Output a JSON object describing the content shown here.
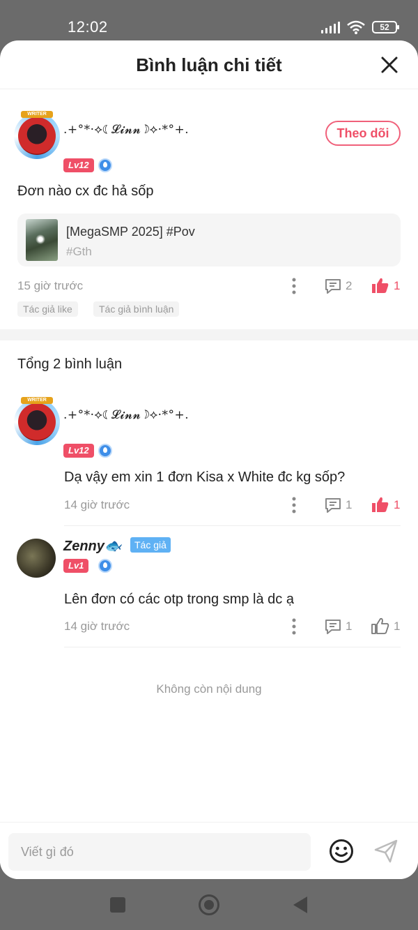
{
  "status_bar": {
    "time": "12:02",
    "battery": "52"
  },
  "header": {
    "title": "Bình luận chi tiết"
  },
  "post": {
    "username": ".+°*·⟡☾𝓛𝓲𝓷𝓷☽⟡·*°+.",
    "level": "Lv12",
    "follow_label": "Theo dõi",
    "text": "Đơn nào cx đc hả sốp",
    "card": {
      "title": "[MegaSMP 2025] #Pov",
      "tag": "#Gth"
    },
    "time": "15 giờ trước",
    "reply_count": "2",
    "like_count": "1",
    "chips": [
      "Tác giả like",
      "Tác giả bình luận"
    ]
  },
  "replies_header": "Tổng 2 bình luận",
  "comments": [
    {
      "username": ".+°*·⟡☾𝓛𝓲𝓷𝓷☽⟡·*°+.",
      "level": "Lv12",
      "text": "Dạ vậy em xin 1 đơn Kisa x White đc kg sốp?",
      "time": "14 giờ trước",
      "reply_count": "1",
      "like_count": "1"
    },
    {
      "username": "Zenny🐟",
      "author_tag": "Tác giả",
      "level": "Lv1",
      "text": "Lên đơn có các otp trong smp là dc ạ",
      "time": "14 giờ trước",
      "reply_count": "1",
      "like_count": "1"
    }
  ],
  "end_text": "Không còn nội dung",
  "composer": {
    "placeholder": "Viết gì đó"
  },
  "colors": {
    "accent": "#ef4f67",
    "author_tag": "#5fb1f4",
    "muted": "#999999"
  }
}
